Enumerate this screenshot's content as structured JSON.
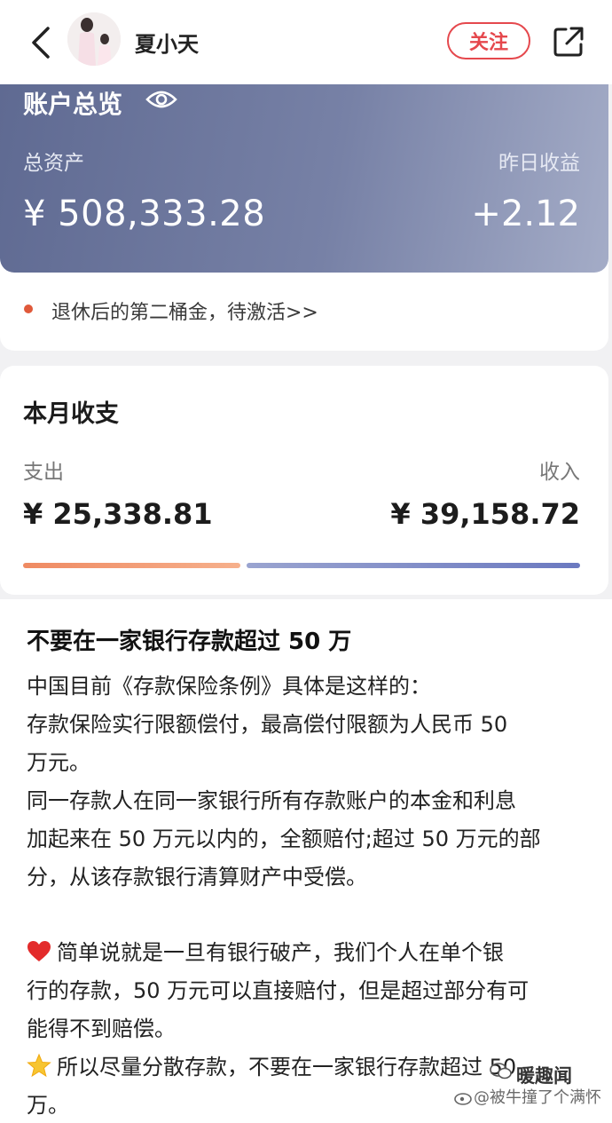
{
  "header": {
    "username": "夏小天",
    "follow_label": "关注"
  },
  "account": {
    "title": "账户总览",
    "total_assets_label": "总资产",
    "total_assets_value": "¥ 508,333.28",
    "yesterday_label": "昨日收益",
    "yesterday_value": "+2.12",
    "promo_text": "退休后的第二桶金，待激活>>"
  },
  "monthly": {
    "title": "本月收支",
    "expense_label": "支出",
    "expense_value": "¥ 25,338.81",
    "income_label": "收入",
    "income_value": "¥ 39,158.72",
    "expense_share": 0.393
  },
  "article": {
    "title": "不要在一家银行存款超过 50 万",
    "p1": "中国目前《存款保险条例》具体是这样的：",
    "p2a": "存款保险实行限额偿付，最高偿付限额为人民币 50",
    "p2b": "万元。",
    "p3a": "同一存款人在同一家银行所有存款账户的本金和利息",
    "p3b": "加起来在 50 万元以内的，全额赔付;超过 50 万元的部",
    "p3c": "分，从该存款银行清算财产中受偿。",
    "p4a": "简单说就是一旦有银行破产，我们个人在单个银",
    "p4b": "行的存款，50 万元可以直接赔付，但是超过部分有可",
    "p4c": "能得不到赔偿。",
    "p5a": "所以尽量分散存款，不要在一家银行存款超过 50",
    "p5b": "万。"
  },
  "watermark": {
    "brand": "暖趣闻",
    "handle": "@被牛撞了个满怀"
  },
  "colors": {
    "accent": "#e5484d",
    "banner": "#6c769d",
    "expense_bar": "#ef8a62",
    "income_bar": "#6b79c0"
  }
}
